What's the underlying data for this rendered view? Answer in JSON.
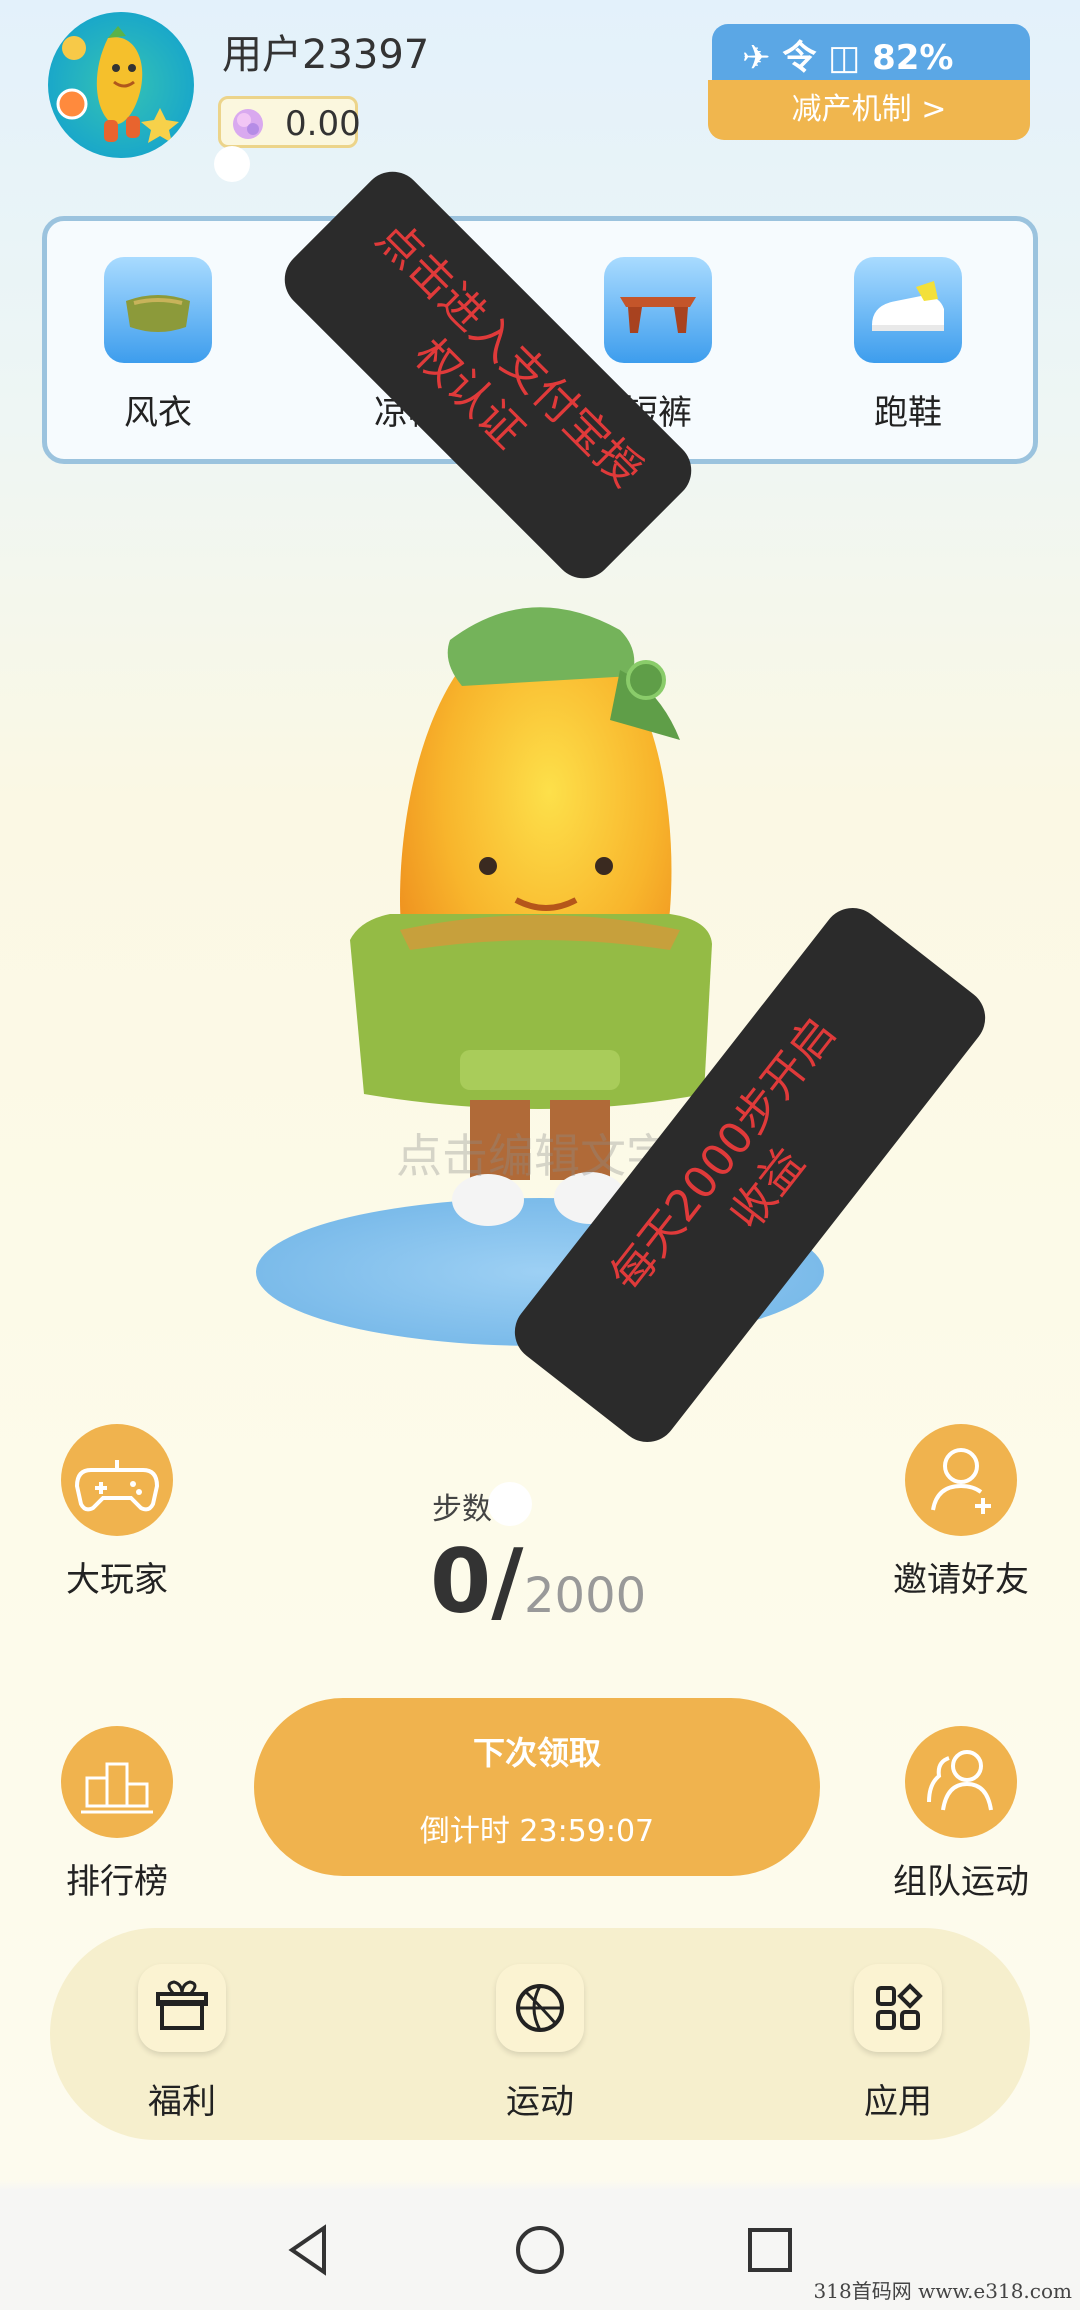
{
  "header": {
    "username": "用户23397",
    "coin_balance": "0.00",
    "status_text": "✈ 令 ◫ 82%",
    "reduce_button": "减产机制 >"
  },
  "wardrobe": {
    "items": [
      {
        "label": "风衣",
        "icon": "coat-icon"
      },
      {
        "label": "凉帽",
        "icon": "hat-icon"
      },
      {
        "label": "短裤",
        "icon": "shorts-icon"
      },
      {
        "label": "跑鞋",
        "icon": "sneaker-icon"
      }
    ]
  },
  "overlays": {
    "top_note": "点击进入支付宝授\n权认证",
    "middle_note": "每天2000步开启\n收益",
    "edit_text": "点击编辑文字"
  },
  "side_buttons": {
    "player": "大玩家",
    "invite": "邀请好友",
    "ranking": "排行榜",
    "team": "组队运动"
  },
  "steps": {
    "label": "步数",
    "current": "0/",
    "goal": "2000"
  },
  "claim": {
    "title": "下次领取",
    "countdown": "倒计时 23:59:07"
  },
  "bottom_nav": {
    "items": [
      {
        "label": "福利",
        "icon": "gift-icon"
      },
      {
        "label": "运动",
        "icon": "basketball-icon"
      },
      {
        "label": "应用",
        "icon": "apps-icon"
      }
    ]
  },
  "watermark": "318首码网  www.e318.com",
  "colors": {
    "accent_orange": "#f0b34e",
    "status_blue": "#5ba7e5",
    "overlay_red": "#e03a3a"
  }
}
